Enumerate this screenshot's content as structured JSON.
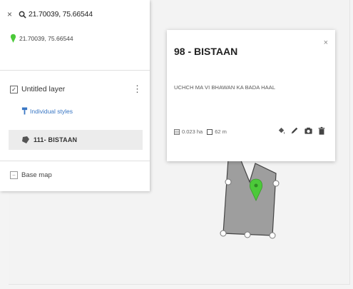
{
  "search": {
    "close_label": "×",
    "query": "21.70039, 75.66544"
  },
  "location": {
    "coords": "21.70039, 75.66544"
  },
  "layer": {
    "checkbox_mark": "✓",
    "title": "Untitled layer",
    "menu_glyph": "⋮",
    "styles_link": "Individual styles",
    "feature_label": "111- BISTAAN"
  },
  "basemap": {
    "label": "Base map"
  },
  "card": {
    "title": "98 - BISTAAN",
    "close_label": "×",
    "description": "UCHCH MA VI BHAWAN KA BADA HAAL",
    "area": "0.023 ha",
    "perimeter": "62 m"
  },
  "colors": {
    "pin_green": "#4cc93a",
    "polygon_fill": "#9e9e9e",
    "link_blue": "#3a77c4"
  },
  "icons": [
    "search-icon",
    "pin-icon",
    "brush-icon",
    "polygon-icon",
    "paint-bucket-icon",
    "pencil-icon",
    "camera-icon",
    "trash-icon",
    "area-icon",
    "perimeter-icon"
  ]
}
